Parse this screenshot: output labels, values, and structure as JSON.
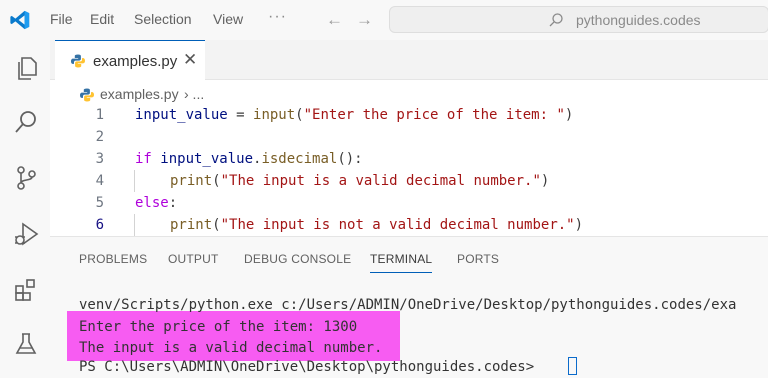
{
  "titlebar": {
    "menu": [
      "File",
      "Edit",
      "Selection",
      "View"
    ],
    "more": "···",
    "back": "←",
    "forward": "→",
    "search_text": "pythonguides.codes"
  },
  "activitybar": {
    "icons": [
      "explorer-icon",
      "search-icon",
      "source-control-icon",
      "run-debug-icon",
      "extensions-icon",
      "testing-icon"
    ]
  },
  "tab": {
    "label": "examples.py",
    "close": "✕"
  },
  "breadcrumb": {
    "file": "examples.py",
    "separator": "› ..."
  },
  "editor": {
    "line_numbers": [
      "1",
      "2",
      "3",
      "4",
      "5",
      "6"
    ],
    "line1": {
      "var": "input_value",
      "eq": " = ",
      "fn": "input",
      "p1": "(",
      "str": "\"Enter the price of the item: \"",
      "p2": ")"
    },
    "line3": {
      "kw": "if",
      "var": " input_value",
      "dot": ".",
      "fn": "isdecimal",
      "rest": "():"
    },
    "line4": {
      "fn": "print",
      "p1": "(",
      "str": "\"The input is a valid decimal number.\"",
      "p2": ")"
    },
    "line5": {
      "kw": "else",
      "rest": ":"
    },
    "line6": {
      "fn": "print",
      "p1": "(",
      "str": "\"The input is not a valid decimal number.\"",
      "p2": ")"
    }
  },
  "panel": {
    "tabs": [
      "PROBLEMS",
      "OUTPUT",
      "DEBUG CONSOLE",
      "TERMINAL",
      "PORTS"
    ],
    "terminal_lines": [
      "venv/Scripts/python.exe c:/Users/ADMIN/OneDrive/Desktop/pythonguides.codes/exa",
      "Enter the price of the item: 1300",
      "The input is a valid decimal number.",
      "PS C:\\Users\\ADMIN\\OneDrive\\Desktop\\pythonguides.codes> "
    ]
  },
  "colors": {
    "accent": "#005fb8",
    "highlight": "#f75cf2",
    "keyword": "#af00db",
    "function": "#795e26",
    "string": "#a31515",
    "variable": "#001080"
  }
}
